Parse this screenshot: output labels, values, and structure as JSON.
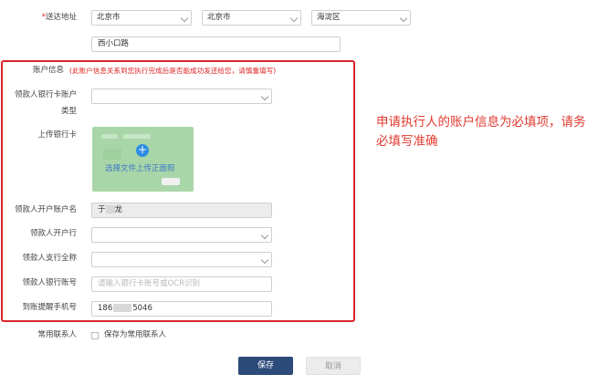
{
  "address": {
    "label": "送达地址",
    "required_mark": "*",
    "province": "北京市",
    "city": "北京市",
    "district": "海淀区",
    "detail": "西小口路"
  },
  "account": {
    "section_label": "账户信息",
    "notice": "(此账户信息关系到您执行完成后是否能成功发还给您，请慎重填写)",
    "fields": {
      "bank_card_type": {
        "label_line1": "领款人银行卡账户",
        "label_line2": "类型",
        "value": ""
      },
      "upload": {
        "label": "上传银行卡",
        "overlay_text": "选择文件上传正面照"
      },
      "holder_name": {
        "label": "领款人开户账户名",
        "value": "于",
        "value_suffix": "龙"
      },
      "bank": {
        "label": "领款人开户行",
        "value": ""
      },
      "branch": {
        "label": "领款人支行全称",
        "value": ""
      },
      "card_number": {
        "label": "领款人银行账号",
        "placeholder": "请输入银行卡账号或OCR识别"
      },
      "phone": {
        "label": "到账提醒手机号",
        "value_prefix": "186",
        "value_suffix": "5046"
      }
    }
  },
  "contact": {
    "label": "常用联系人",
    "checkbox_label": "保存为常用联系人",
    "checked": false
  },
  "buttons": {
    "save": "保存",
    "cancel": "取消"
  },
  "annotation": "申请执行人的账户信息为必填项，请务必填写准确",
  "colors": {
    "primary": "#2c4a7a",
    "highlight_border": "#d9242a",
    "annotation_text": "#e03a2f",
    "upload_bg": "#a9d6a9"
  }
}
